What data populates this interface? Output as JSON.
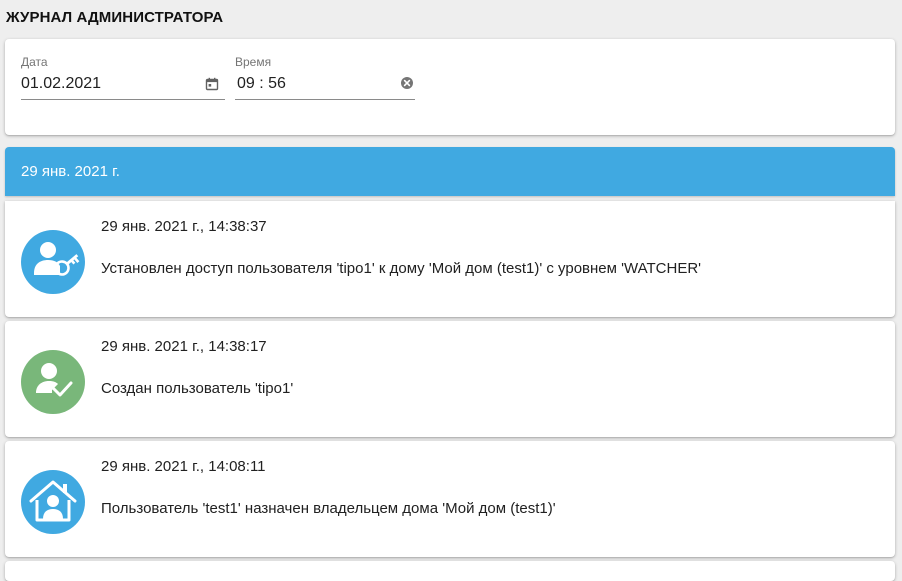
{
  "page": {
    "title": "ЖУРНАЛ АДМИНИСТРАТОРА"
  },
  "filters": {
    "date": {
      "label": "Дата",
      "value": "01.02.2021",
      "icon": "calendar-icon"
    },
    "time": {
      "label": "Время",
      "value": "09 : 56",
      "icon": "clear-circle-icon"
    }
  },
  "group": {
    "date_header": "29 янв. 2021 г."
  },
  "events": [
    {
      "timestamp": "29 янв. 2021 г., 14:38:37",
      "message": "Установлен доступ пользователя 'tipo1' к дому 'Мой дом (test1)' с уровнем 'WATCHER'",
      "icon": "user-key-icon",
      "color": "#40a9e1"
    },
    {
      "timestamp": "29 янв. 2021 г., 14:38:17",
      "message": "Создан пользователь 'tipo1'",
      "icon": "user-check-icon",
      "color": "#79b77a"
    },
    {
      "timestamp": "29 янв. 2021 г., 14:08:11",
      "message": "Пользователь 'test1' назначен владельцем дома 'Мой дом (test1)'",
      "icon": "house-user-icon",
      "color": "#40a9e1"
    }
  ],
  "colors": {
    "accent": "#40a9e1",
    "success": "#79b77a",
    "background": "#eeeeee"
  }
}
